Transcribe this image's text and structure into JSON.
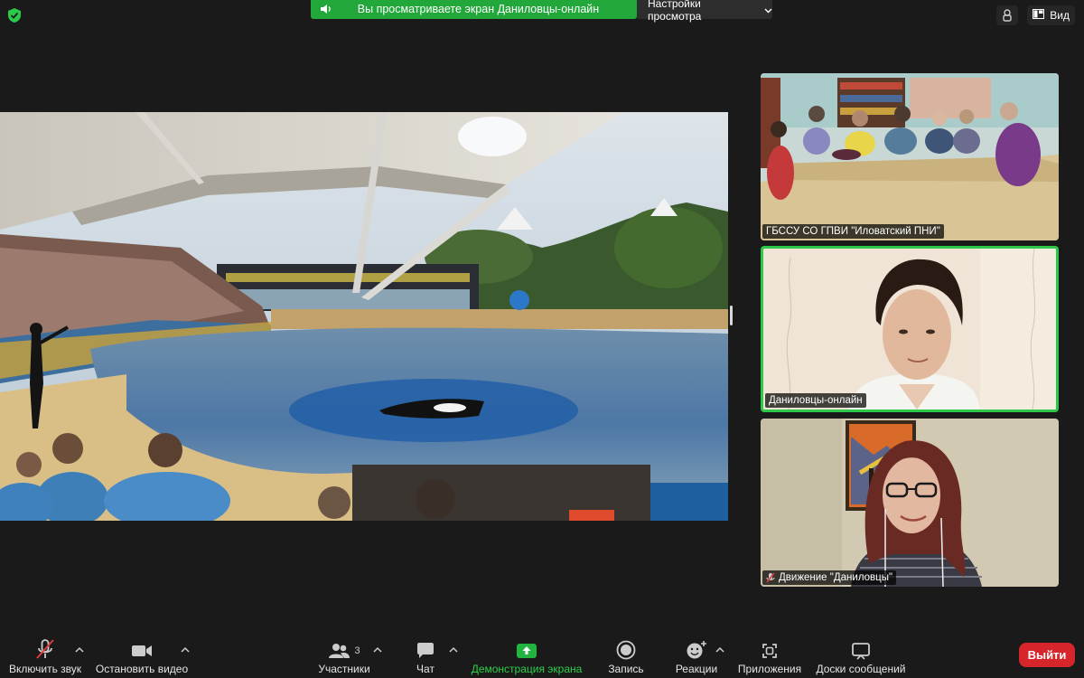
{
  "top": {
    "share_banner": "Вы просматриваете экран Даниловцы-онлайн",
    "view_options": "Настройки просмотра",
    "view_button": "Вид"
  },
  "tiles": [
    {
      "name": "ГБССУ СО ГПВИ \"Иловатский ПНИ\"",
      "muted": false,
      "active_speaker": false
    },
    {
      "name": "Даниловцы-онлайн",
      "muted": false,
      "active_speaker": true
    },
    {
      "name": "Движение \"Даниловцы\"",
      "muted": true,
      "active_speaker": false
    }
  ],
  "toolbar": {
    "mute": "Включить звук",
    "video": "Остановить видео",
    "participants": "Участники",
    "participants_count": "3",
    "chat": "Чат",
    "share": "Демонстрация экрана",
    "record": "Запись",
    "reactions": "Реакции",
    "apps": "Приложения",
    "whiteboard": "Доски сообщений",
    "leave": "Выйти"
  },
  "colors": {
    "share_green": "#22a83a",
    "active_border": "#2cc84a",
    "leave_red": "#d6262c",
    "background": "#1a1a1a"
  },
  "icons": [
    "shield-check-icon",
    "speaker-icon",
    "chevron-down-icon",
    "view-icon",
    "mic-muted-icon",
    "camera-icon",
    "participants-icon",
    "chat-icon",
    "share-screen-icon",
    "record-icon",
    "reactions-icon",
    "apps-icon",
    "whiteboard-icon"
  ]
}
